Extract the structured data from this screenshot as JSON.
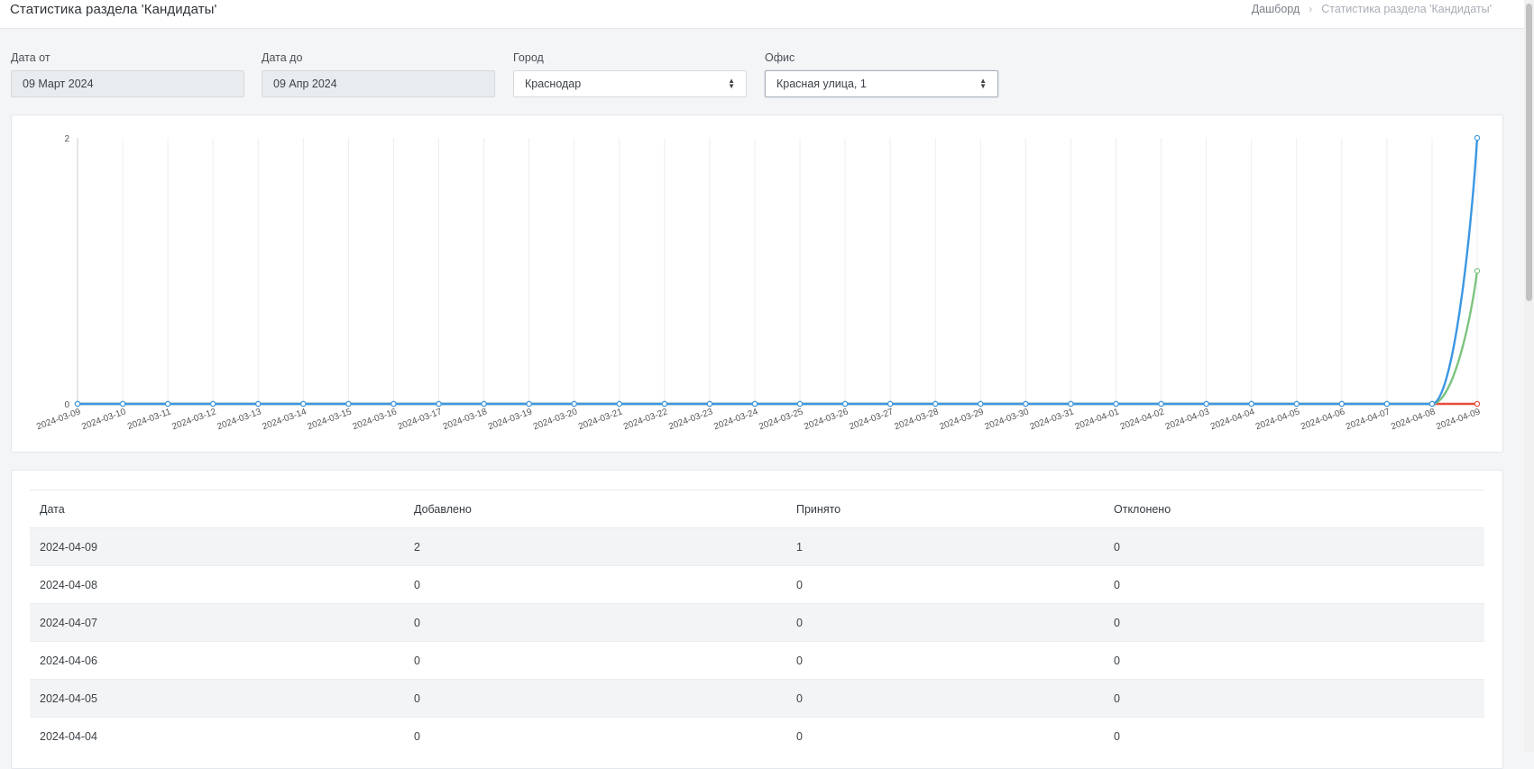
{
  "header": {
    "title": "Статистика раздела 'Кандидаты'",
    "breadcrumb": [
      "Дашборд",
      "Статистика раздела 'Кандидаты'"
    ]
  },
  "filters": {
    "date_from": {
      "label": "Дата от",
      "value": "09 Март 2024"
    },
    "date_to": {
      "label": "Дата до",
      "value": "09 Апр 2024"
    },
    "city": {
      "label": "Город",
      "value": "Краснодар"
    },
    "office": {
      "label": "Офис",
      "value": "Красная улица, 1"
    }
  },
  "chart_data": {
    "type": "line",
    "title": "",
    "xlabel": "",
    "ylabel": "",
    "ylim": [
      0,
      2
    ],
    "yticks": [
      0,
      2
    ],
    "grid": "vertical",
    "legend": "none",
    "x": [
      "2024-03-09",
      "2024-03-10",
      "2024-03-11",
      "2024-03-12",
      "2024-03-13",
      "2024-03-14",
      "2024-03-15",
      "2024-03-16",
      "2024-03-17",
      "2024-03-18",
      "2024-03-19",
      "2024-03-20",
      "2024-03-21",
      "2024-03-22",
      "2024-03-23",
      "2024-03-24",
      "2024-03-25",
      "2024-03-26",
      "2024-03-27",
      "2024-03-28",
      "2024-03-29",
      "2024-03-30",
      "2024-03-31",
      "2024-04-01",
      "2024-04-02",
      "2024-04-03",
      "2024-04-04",
      "2024-04-05",
      "2024-04-06",
      "2024-04-07",
      "2024-04-08",
      "2024-04-09"
    ],
    "series": [
      {
        "color": "#e74c3c",
        "values": [
          0,
          0,
          0,
          0,
          0,
          0,
          0,
          0,
          0,
          0,
          0,
          0,
          0,
          0,
          0,
          0,
          0,
          0,
          0,
          0,
          0,
          0,
          0,
          0,
          0,
          0,
          0,
          0,
          0,
          0,
          0,
          0
        ]
      },
      {
        "color": "#7cc47f",
        "values": [
          0,
          0,
          0,
          0,
          0,
          0,
          0,
          0,
          0,
          0,
          0,
          0,
          0,
          0,
          0,
          0,
          0,
          0,
          0,
          0,
          0,
          0,
          0,
          0,
          0,
          0,
          0,
          0,
          0,
          0,
          0,
          1
        ]
      },
      {
        "color": "#3b97e3",
        "values": [
          0,
          0,
          0,
          0,
          0,
          0,
          0,
          0,
          0,
          0,
          0,
          0,
          0,
          0,
          0,
          0,
          0,
          0,
          0,
          0,
          0,
          0,
          0,
          0,
          0,
          0,
          0,
          0,
          0,
          0,
          0,
          2
        ]
      }
    ]
  },
  "table": {
    "headers": [
      "Дата",
      "Добавлено",
      "Принято",
      "Отклонено"
    ],
    "rows": [
      [
        "2024-04-09",
        "2",
        "1",
        "0"
      ],
      [
        "2024-04-08",
        "0",
        "0",
        "0"
      ],
      [
        "2024-04-07",
        "0",
        "0",
        "0"
      ],
      [
        "2024-04-06",
        "0",
        "0",
        "0"
      ],
      [
        "2024-04-05",
        "0",
        "0",
        "0"
      ],
      [
        "2024-04-04",
        "0",
        "0",
        "0"
      ]
    ]
  }
}
